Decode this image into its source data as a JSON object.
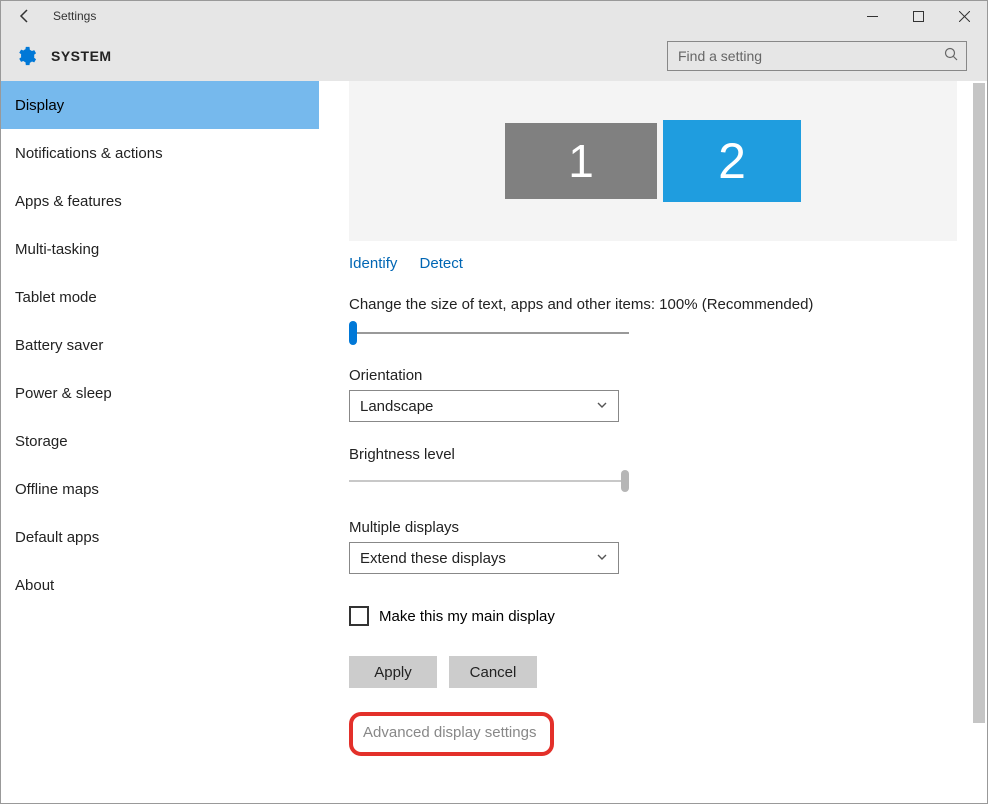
{
  "window": {
    "title": "Settings"
  },
  "header": {
    "section": "SYSTEM",
    "search_placeholder": "Find a setting"
  },
  "sidebar": {
    "items": [
      {
        "label": "Display",
        "selected": true
      },
      {
        "label": "Notifications & actions"
      },
      {
        "label": "Apps & features"
      },
      {
        "label": "Multi-tasking"
      },
      {
        "label": "Tablet mode"
      },
      {
        "label": "Battery saver"
      },
      {
        "label": "Power & sleep"
      },
      {
        "label": "Storage"
      },
      {
        "label": "Offline maps"
      },
      {
        "label": "Default apps"
      },
      {
        "label": "About"
      }
    ]
  },
  "display": {
    "monitors": {
      "one": "1",
      "two": "2"
    },
    "identify": "Identify",
    "detect": "Detect",
    "scale_label": "Change the size of text, apps and other items: 100% (Recommended)",
    "orientation_label": "Orientation",
    "orientation_value": "Landscape",
    "brightness_label": "Brightness level",
    "multidisplay_label": "Multiple displays",
    "multidisplay_value": "Extend these displays",
    "main_display_checkbox": "Make this my main display",
    "apply": "Apply",
    "cancel": "Cancel",
    "advanced": "Advanced display settings"
  }
}
